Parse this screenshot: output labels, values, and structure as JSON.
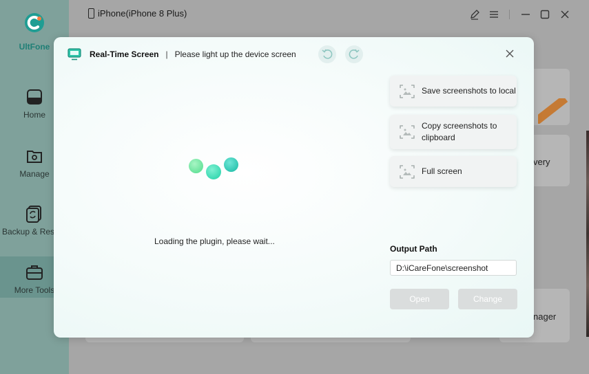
{
  "app": {
    "name": "UltFone",
    "brand_color": "#1f9d93"
  },
  "sidebar": {
    "items": [
      {
        "label": "Home",
        "icon": "home-icon"
      },
      {
        "label": "Manage",
        "icon": "folder-gear-icon"
      },
      {
        "label": "Backup & Rest",
        "icon": "backup-restore-icon"
      },
      {
        "label": "More Tools",
        "icon": "toolbox-icon",
        "active": true
      }
    ]
  },
  "header": {
    "device_name": "iPhone(iPhone 8 Plus)"
  },
  "background": {
    "card_text_1": "very",
    "card_text_2": "nager"
  },
  "modal": {
    "title": "Real-Time Screen",
    "separator": "|",
    "subtitle": "Please light up the device screen",
    "loading_text": "Loading the plugin, please wait...",
    "actions": [
      {
        "label": "Save screenshots to local",
        "icon": "screenshot-icon"
      },
      {
        "label": "Copy screenshots to clipboard",
        "icon": "screenshot-icon"
      },
      {
        "label": "Full screen",
        "icon": "fullscreen-icon"
      }
    ],
    "output_path_label": "Output Path",
    "output_path_value": "D:\\iCareFone\\screenshot",
    "open_button": "Open",
    "change_button": "Change"
  },
  "colors": {
    "accent": "#2ec4a9",
    "sidebar": "#7fa19b",
    "sidebar_active": "#6a948e",
    "button_disabled": "#dadddd"
  }
}
